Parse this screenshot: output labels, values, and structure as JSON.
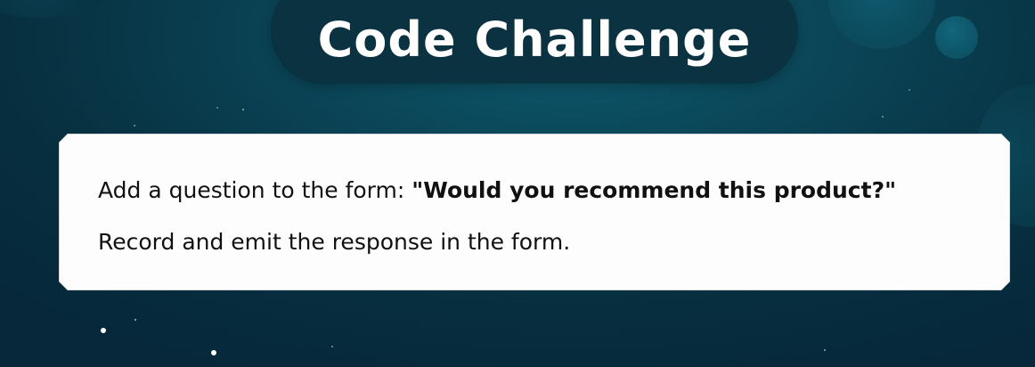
{
  "title": "Code Challenge",
  "card": {
    "line1_prefix": "Add a question to the form: ",
    "line1_emphasis": "\"Would you recommend this product?\"",
    "line2": "Record and emit the response in the form."
  },
  "colors": {
    "background": "#0a4456",
    "title_pill": "#0a3241",
    "card": "#fdfdfd",
    "text": "#111111"
  }
}
